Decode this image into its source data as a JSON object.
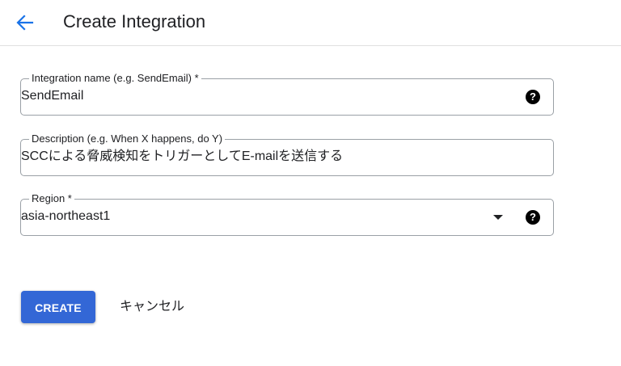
{
  "header": {
    "back_icon": "arrow-left-icon",
    "title": "Create Integration",
    "accent_color": "#1a73e8"
  },
  "form": {
    "name_field": {
      "label": "Integration name (e.g. SendEmail) *",
      "value": "SendEmail",
      "help_icon": "question-circle-icon",
      "help_glyph": "?"
    },
    "description_field": {
      "label": "Description (e.g. When X happens, do Y)",
      "value": "SCCによる脅威検知をトリガーとしてE-mailを送信する"
    },
    "region_field": {
      "label": "Region *",
      "value": "asia-northeast1",
      "dropdown_icon": "caret-down-icon",
      "help_icon": "question-circle-icon",
      "help_glyph": "?"
    }
  },
  "actions": {
    "create_label": "CREATE",
    "cancel_label": "キャンセル",
    "primary_color": "#3367d6"
  }
}
